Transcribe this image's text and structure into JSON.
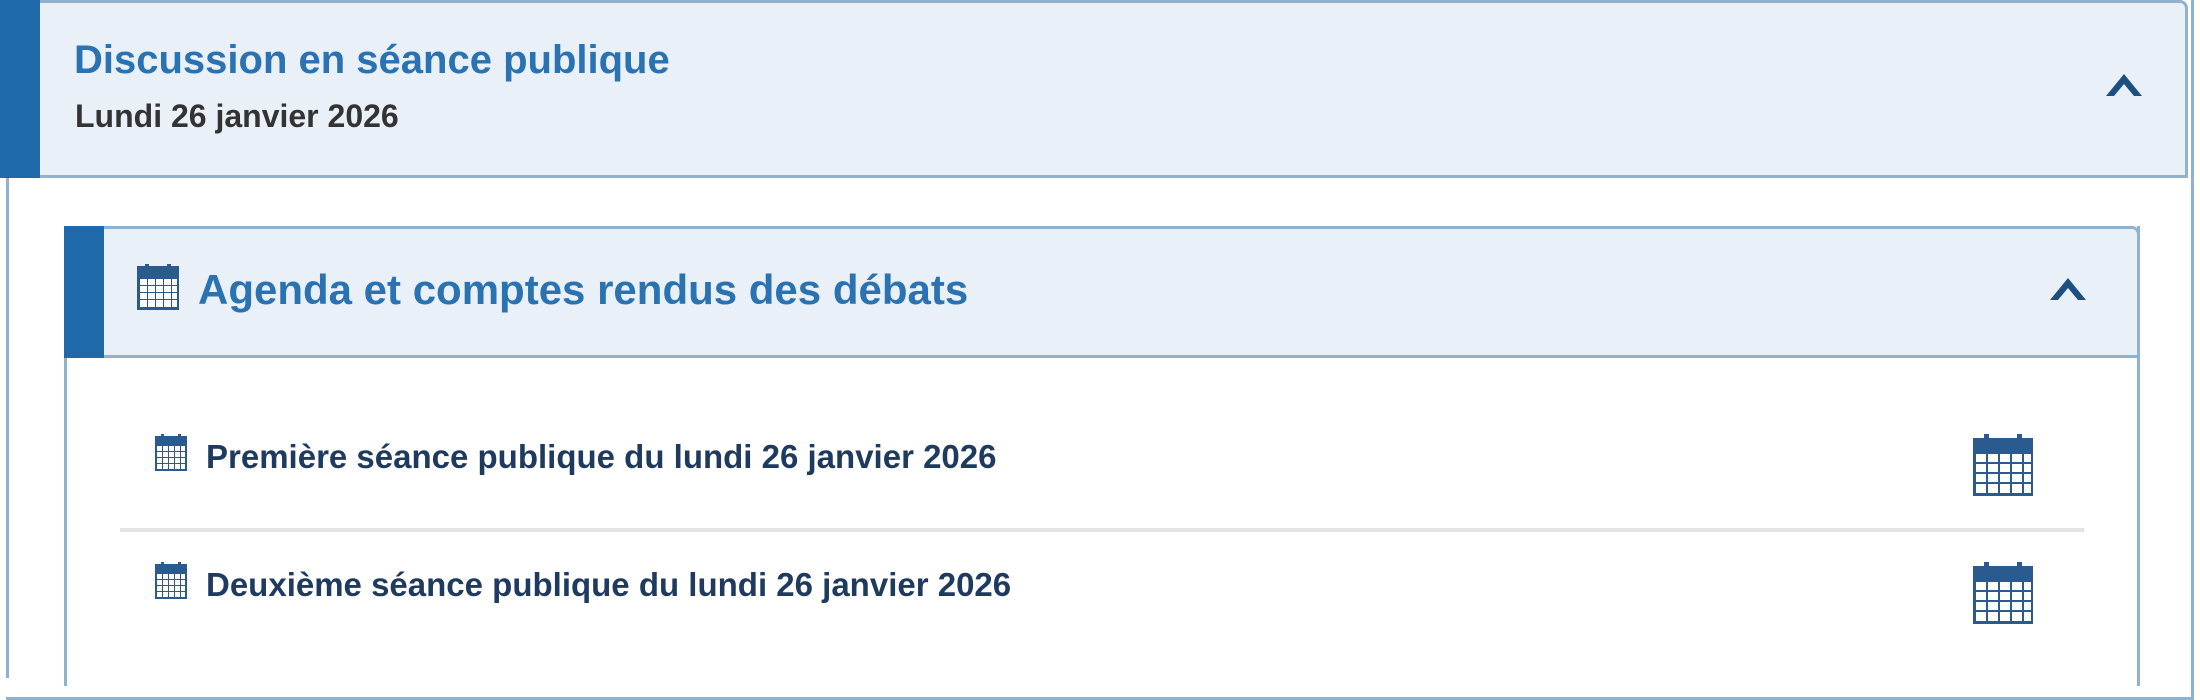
{
  "colors": {
    "accent": "#1f69ab",
    "title": "#2a72b2",
    "header_bg": "#e9f0f8",
    "border": "#8fb2ce",
    "item_text": "#1e3a5f",
    "icon": "#2a5a8e"
  },
  "outer_section": {
    "title": "Discussion en séance publique",
    "subtitle": "Lundi 26 janvier 2026",
    "toggle_icon": "chevron-up-icon"
  },
  "inner_section": {
    "icon": "calendar-icon",
    "title": "Agenda et comptes rendus des débats",
    "toggle_icon": "chevron-up-icon"
  },
  "items": [
    {
      "label": "Première séance publique du lundi 26 janvier 2026",
      "icon": "calendar-icon",
      "action_icon": "calendar-icon"
    },
    {
      "label": "Deuxième séance publique du lundi 26 janvier 2026",
      "icon": "calendar-icon",
      "action_icon": "calendar-icon"
    }
  ]
}
